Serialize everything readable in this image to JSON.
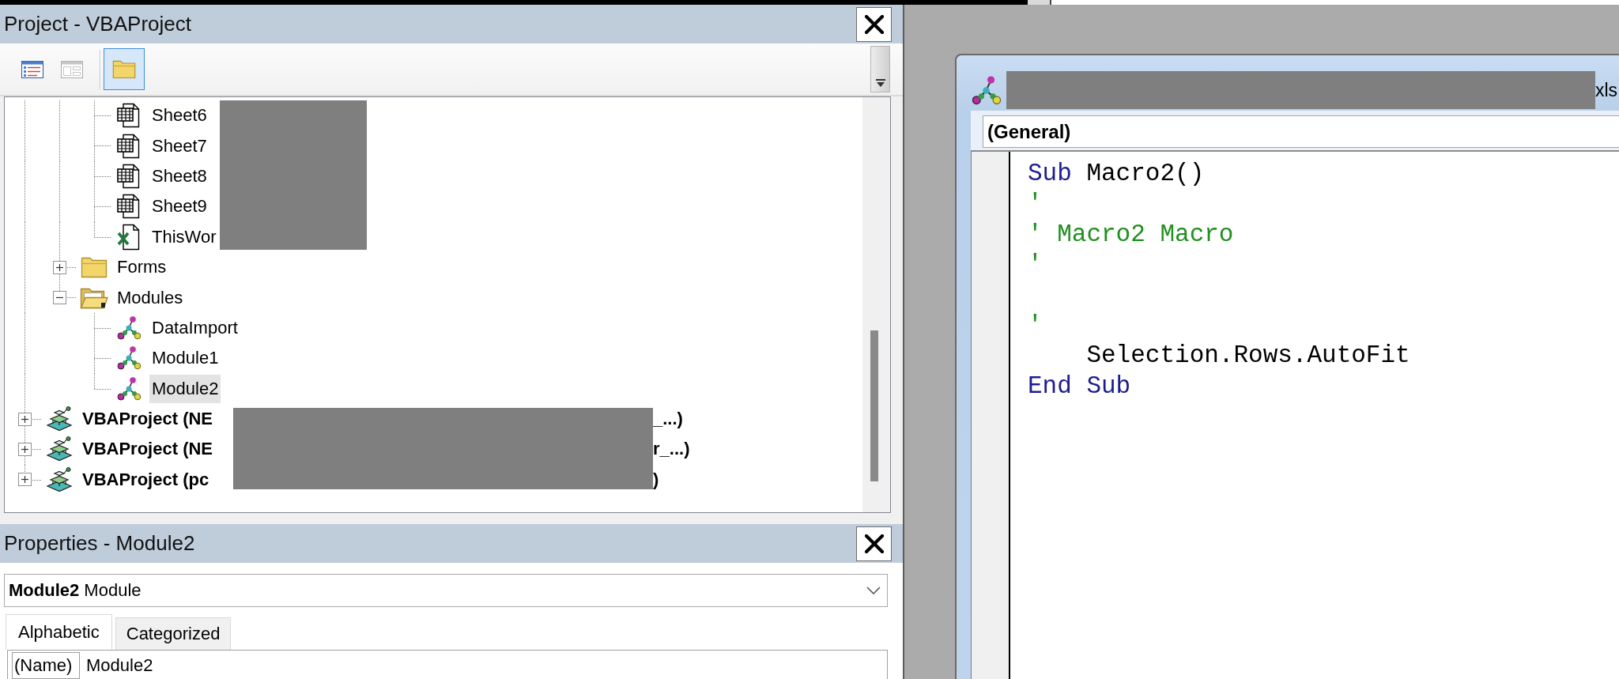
{
  "project_explorer": {
    "title": "Project - VBAProject",
    "toolbar": {
      "view_buttons": [
        {
          "disabled": false
        },
        {
          "disabled": true
        }
      ],
      "folder_toggle": {
        "selected": true
      }
    },
    "tree": [
      {
        "children": [
          {
            "children": [
              {
                "kind": "sheet",
                "label": "Sheet6",
                "selected": false
              },
              {
                "kind": "sheet",
                "label": "Sheet7",
                "selected": false
              },
              {
                "kind": "sheet",
                "label": "Sheet8",
                "selected": false
              },
              {
                "kind": "sheet",
                "label": "Sheet9",
                "selected": false
              },
              {
                "kind": "workbook",
                "label": "ThisWor",
                "selected": false
              }
            ]
          },
          {
            "kind": "folder",
            "label": "Forms",
            "expanded": false,
            "selected": false
          },
          {
            "kind": "folder",
            "label": "Modules",
            "expanded": true,
            "selected": false,
            "children": [
              {
                "kind": "module",
                "label": "DataImport",
                "selected": false
              },
              {
                "kind": "module",
                "label": "Module1",
                "selected": false
              },
              {
                "kind": "module",
                "label": "Module2",
                "selected": true
              }
            ]
          }
        ]
      },
      {
        "kind": "project",
        "label": "VBAProject (NE",
        "label_end": "_...)",
        "expanded": false,
        "selected": false
      },
      {
        "kind": "project",
        "label": "VBAProject (NE",
        "label_end": "r_...)",
        "expanded": false,
        "selected": false
      },
      {
        "kind": "project",
        "label": "VBAProject (pc",
        "label_end": ")",
        "expanded": false,
        "selected": false
      }
    ]
  },
  "properties": {
    "title": "Properties - Module2",
    "object_selector": "**Module2** Module",
    "tabs": [
      {
        "label": "Alphabetic",
        "selected": true
      },
      {
        "label": "Categorized",
        "selected": false
      }
    ],
    "rows": [
      {
        "name": "(Name)",
        "value": "Module2"
      }
    ]
  },
  "code_window": {
    "title_end": "xls",
    "object_selector": "(General)",
    "lines": [
      {
        "kind": "code",
        "tokens": [
          {
            "kind": "keyword",
            "text": "Sub"
          },
          {
            "kind": "plain",
            "text": " Macro2()"
          }
        ]
      },
      {
        "kind": "code",
        "tokens": [
          {
            "kind": "comment",
            "text": "'"
          }
        ]
      },
      {
        "kind": "code",
        "tokens": [
          {
            "kind": "comment",
            "text": "' Macro2 Macro"
          }
        ]
      },
      {
        "kind": "code",
        "tokens": [
          {
            "kind": "comment",
            "text": "'"
          }
        ]
      },
      {
        "kind": "blank"
      },
      {
        "kind": "code",
        "tokens": [
          {
            "kind": "comment",
            "text": "'"
          }
        ]
      },
      {
        "kind": "code",
        "tokens": [
          {
            "kind": "plain",
            "text": "    Selection.Rows.AutoFit"
          }
        ]
      },
      {
        "kind": "code",
        "tokens": [
          {
            "kind": "keyword",
            "text": "End Sub"
          }
        ]
      }
    ]
  }
}
